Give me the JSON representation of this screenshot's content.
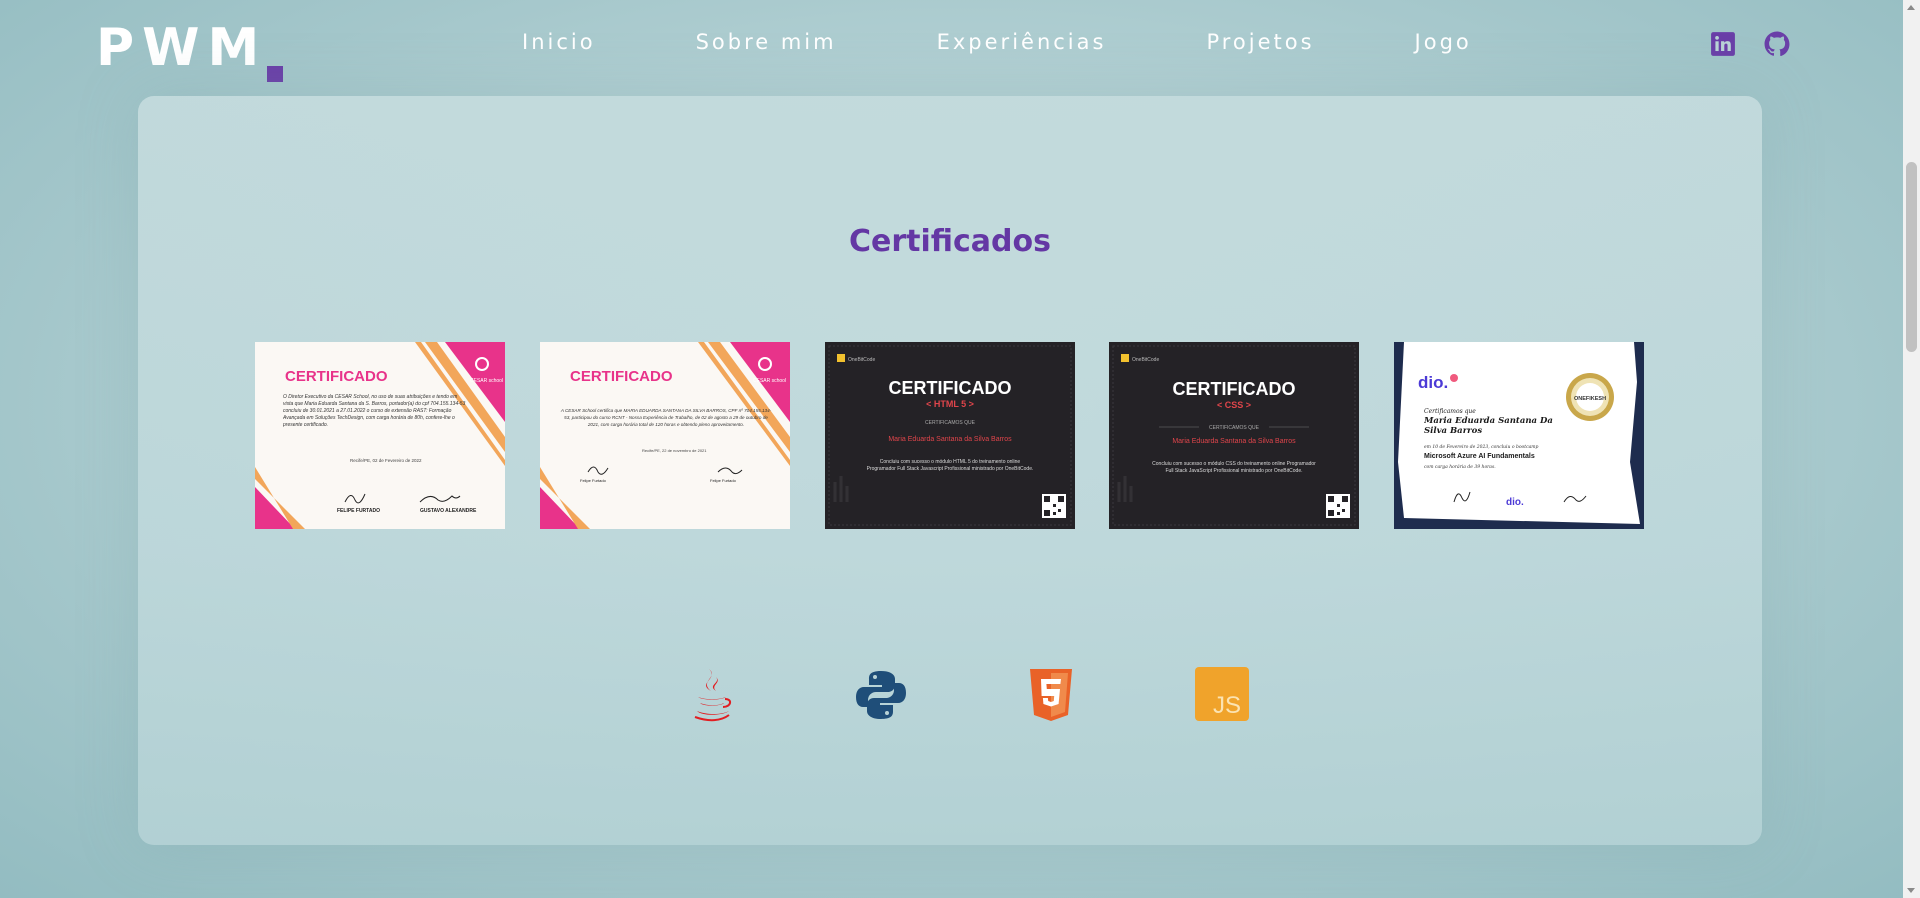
{
  "brand": {
    "logo_text": "PWM",
    "accent": "#6a3fa8"
  },
  "nav": {
    "items": [
      {
        "label": "Inicio"
      },
      {
        "label": "Sobre mim"
      },
      {
        "label": "Experiências"
      },
      {
        "label": "Projetos"
      },
      {
        "label": "Jogo"
      }
    ]
  },
  "socials": [
    {
      "icon": "linkedin-icon"
    },
    {
      "icon": "github-icon"
    }
  ],
  "certificates_section": {
    "title": "Certificados",
    "title_color": "#6437a4",
    "certificates": [
      {
        "heading": "CERTIFICADO",
        "school": "CESAR school",
        "body": "O Diretor Executivo da CESAR School, no uso de suas atribuições e tendo em vista que Maria Eduarda Santana da S. Barros, portador(a) do cpf 704.155.134-53 concluiu de 30.01.2021 a 27.01.2022 o curso de extensão RAST: Formação Avançada em Soluções TechDesign, com carga horária de 80h, confere-lhe o presente certificado.",
        "place_date": "Recife/PE, 02 de Fevereiro de 2022",
        "signer1": "FELIPE FURTADO",
        "signer2": "GUSTAVO ALEXANDRE"
      },
      {
        "heading": "CERTIFICADO",
        "school": "CESAR school",
        "body": "A CESAR School certifica que MARIA EDUARDA SANTANA DA SILVA BARROS, CPF nº 704.155.134-53, participou do curso RCNT - Nossa Experiência de Trabalho, de 02 de agosto a 29 de outubro de 2021, com carga horária total de 120 horas e obtendo pleno aproveitamento.",
        "place_date": "Recife/PE, 22 de novembro de 2021",
        "signer1": "Felipe Furtado",
        "signer2": "Felipe Furtado"
      },
      {
        "heading": "CERTIFICADO",
        "module": "< HTML 5 >",
        "school": "OneBitCode",
        "certify_line": "CERTIFICAMOS QUE",
        "name": "Maria Eduarda Santana da Silva Barros",
        "body": "Concluiu com sucesso o módulo HTML 5 do treinamento online Programador Full Stack Javascript Profissional ministrado por OneBitCode."
      },
      {
        "heading": "CERTIFICADO",
        "module": "< CSS >",
        "school": "OneBitCode",
        "certify_line": "CERTIFICAMOS QUE",
        "name": "Maria Eduarda Santana da Silva Barros",
        "body": "Concluiu com sucesso o módulo CSS do treinamento online Programador Full Stack JavaScript Profissional ministrado por OneBitCode."
      },
      {
        "brand": "dio.",
        "certify_line": "Certificamos que",
        "name": "Maria Eduarda Santana Da Silva Barros",
        "body": "em 10 de Fevereiro de 2023, concluiu o bootcamp",
        "course": "Microsoft Azure AI Fundamentals",
        "hours": "com carga horária de 39 horas.",
        "badge": "ONEFIKESH"
      }
    ]
  },
  "technologies": [
    {
      "name": "Java",
      "icon": "java-icon",
      "color": "#e11e22"
    },
    {
      "name": "Python",
      "icon": "python-icon",
      "color": "#1f4e79"
    },
    {
      "name": "HTML5",
      "icon": "html5-icon",
      "color": "#e96228"
    },
    {
      "name": "JavaScript",
      "icon": "js-icon",
      "color": "#f0a32b"
    }
  ]
}
